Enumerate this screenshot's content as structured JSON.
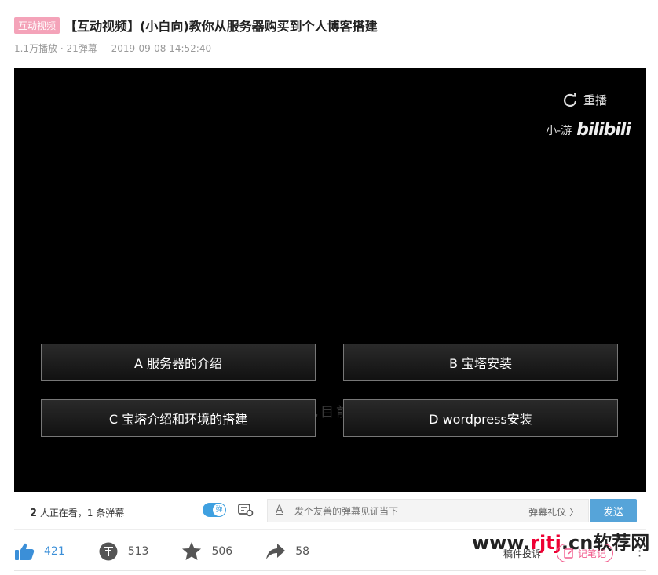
{
  "header": {
    "tag": "互动视频",
    "title": "【互动视频】(小白向)教你从服务器购买到个人博客搭建",
    "plays": "1.1万播放 · 21弹幕",
    "date": "2019-09-08 14:52:40"
  },
  "player": {
    "replay_label": "重播",
    "watermark_user": "小-游",
    "watermark_logo": "bilibili",
    "options": [
      {
        "label": "A 服务器的介绍"
      },
      {
        "label": "B 宝塔安装"
      },
      {
        "label": "C 宝塔介绍和环境的搭建"
      },
      {
        "label": "D wordpress安装"
      }
    ],
    "hint": "你可以根据你自己目前的进度进行选择"
  },
  "danmaku_bar": {
    "viewers_count": "2",
    "viewers_text": " 人正在看，",
    "danmaku_count": "1 条弹幕",
    "toggle_label": "弹",
    "input_placeholder": "发个友善的弹幕见证当下",
    "etiquette": "弹幕礼仪 〉",
    "send_label": "发送"
  },
  "actions": {
    "like": "421",
    "coin": "513",
    "favorite": "506",
    "share": "58",
    "report": "稿件投诉",
    "note": "记笔记"
  },
  "site_watermark": {
    "prefix": "www.",
    "highlight": "rjtj",
    "suffix": ".cn软荐网"
  },
  "colors": {
    "tag_bg": "#f4a3b9",
    "accent_blue": "#3fa0e0",
    "send_bg": "#56a4d9",
    "note_pink": "#f25d8e"
  }
}
